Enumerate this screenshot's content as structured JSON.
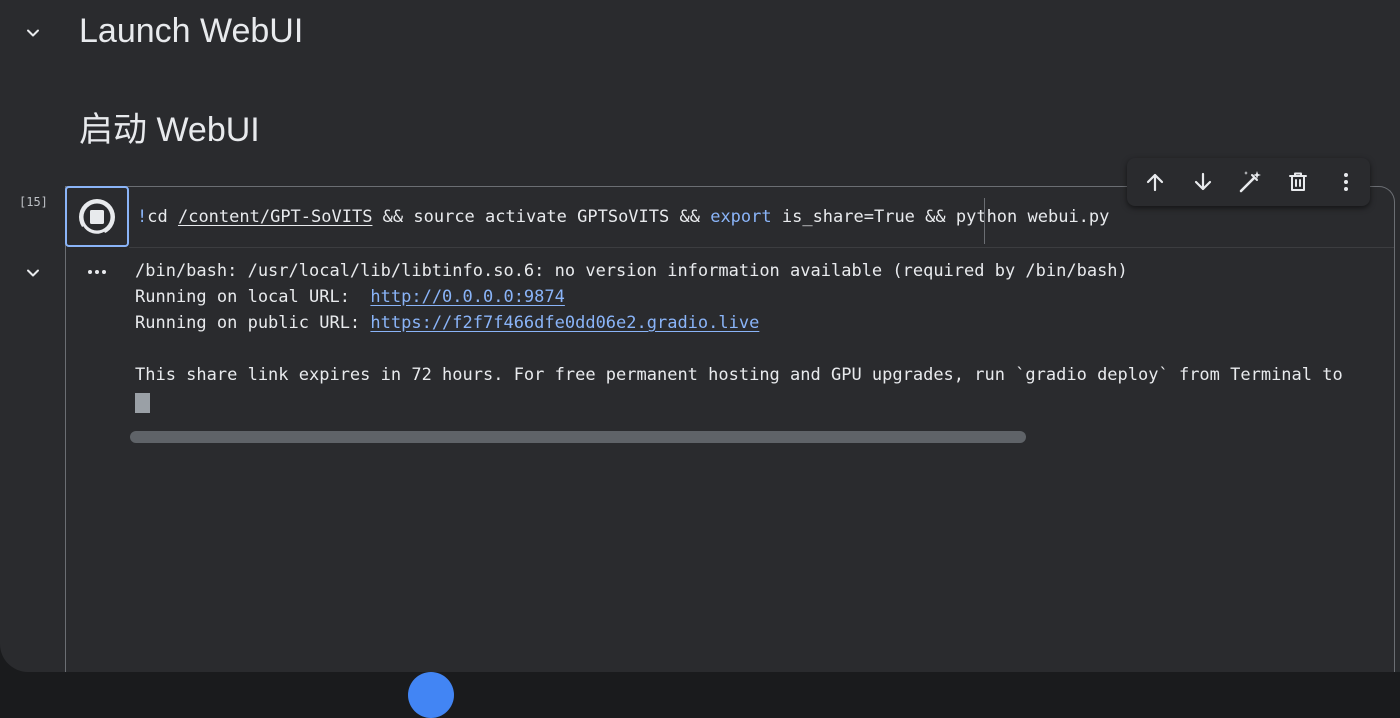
{
  "section": {
    "title": "Launch WebUI",
    "subtitle": "启动 WebUI",
    "collapse_icon": "chevron-down-icon"
  },
  "cell": {
    "execution_count": "[15]",
    "run_state_icon": "stop-running-icon",
    "code": {
      "bang": "!",
      "cmd1": "cd ",
      "path": "/content/GPT-SoVITS",
      "seg2": " && source activate GPTSoVITS && ",
      "kw_export": "export",
      "seg3": " is_share=True && ",
      "seg4": "python webui.py"
    },
    "toolbar": [
      {
        "name": "move-up",
        "icon": "arrow-up-icon"
      },
      {
        "name": "move-down",
        "icon": "arrow-down-icon"
      },
      {
        "name": "edit",
        "icon": "magic-wand-icon"
      },
      {
        "name": "delete",
        "icon": "trash-icon"
      },
      {
        "name": "more",
        "icon": "more-vertical-icon"
      }
    ]
  },
  "output": {
    "collapse_icon": "chevron-down-icon",
    "more_icon": "more-horizontal-icon",
    "line1": "/bin/bash: /usr/local/lib/libtinfo.so.6: no version information available (required by /bin/bash)",
    "local_label": "Running on local URL:  ",
    "local_url": "http://0.0.0.0:9874",
    "public_label": "Running on public URL: ",
    "public_url": "https://f2f7f466dfe0dd06e2.gradio.live",
    "notice": "This share link expires in 72 hours. For free permanent hosting and GPU upgrades, run `gradio deploy` from Terminal to"
  },
  "colors": {
    "background": "#2a2b2e",
    "text": "#e8eaed",
    "accent": "#8ab4f8",
    "border": "#6b6e73"
  }
}
